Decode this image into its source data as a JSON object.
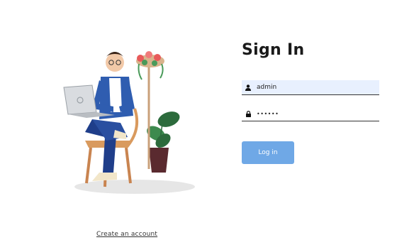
{
  "signin": {
    "title": "Sign In",
    "username_value": "admin",
    "password_value": "••••••",
    "login_label": "Log in"
  },
  "footer": {
    "create_account_label": "Create an account"
  },
  "icons": {
    "username": "user-icon",
    "password": "lock-icon"
  },
  "colors": {
    "button_bg": "#6fa8e6",
    "input_autofill_bg": "#e8f0fe"
  }
}
